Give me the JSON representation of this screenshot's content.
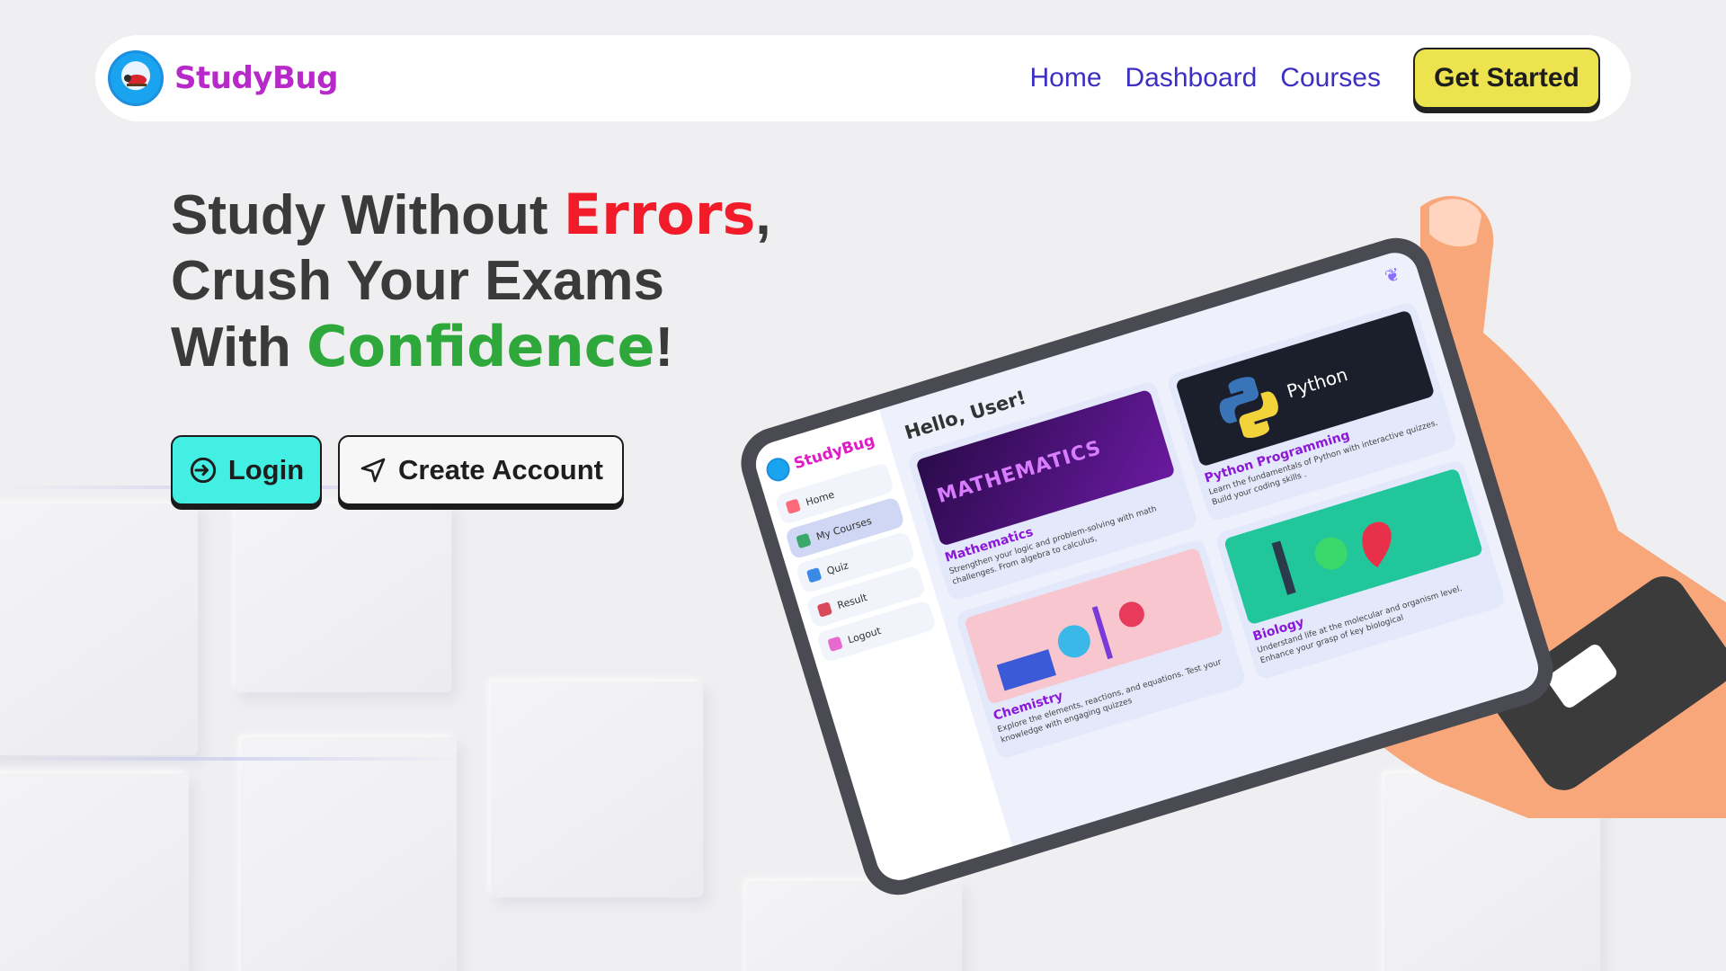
{
  "nav": {
    "brand": "StudyBug",
    "links": [
      "Home",
      "Dashboard",
      "Courses"
    ],
    "cta": "Get Started"
  },
  "hero": {
    "line1_pre": "Study Without ",
    "line1_highlight": "Errors",
    "line1_post": ",",
    "line2": "Crush Your Exams",
    "line3_pre": "With ",
    "line3_highlight": "Confidence",
    "line3_post": "!"
  },
  "actions": {
    "login": "Login",
    "create": "Create Account"
  },
  "tablet": {
    "brand": "StudyBug",
    "greeting": "Hello, User!",
    "sidebar": [
      "Home",
      "My Courses",
      "Quiz",
      "Result",
      "Logout"
    ],
    "cards": [
      {
        "title": "Mathematics",
        "image_text": "MATHEMATICS",
        "desc": "Strengthen your logic and problem-solving with math challenges. From algebra to calculus,"
      },
      {
        "title": "Python Programming",
        "image_text": "Python",
        "desc": "Learn the fundamentals of Python with interactive quizzes. Build your coding skills ."
      },
      {
        "title": "Chemistry",
        "desc": "Explore the elements, reactions, and equations. Test your knowledge with engaging quizzes"
      },
      {
        "title": "Biology",
        "desc": "Understand life at the molecular and organism level. Enhance your grasp of key biological"
      }
    ]
  },
  "colors": {
    "brand": "#b829c9",
    "nav_link": "#3d2fc4",
    "cta_yellow": "#ece34f",
    "login_cyan": "#43efe2",
    "highlight_red": "#f21b2a",
    "highlight_green": "#2ea83a"
  },
  "icons": {
    "login": "login-arrow-icon",
    "create": "send-arrow-icon",
    "ribbon": "ribbon-icon"
  }
}
